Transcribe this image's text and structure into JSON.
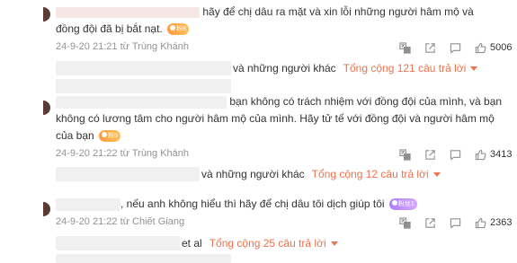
{
  "comments": [
    {
      "text_line1": "hãy để chị dâu ra mặt và xin lỗi những người hâm mộ và",
      "text_line2": "đồng đội đã bị bắt nạt.",
      "badge": "粉8",
      "date": "24-9-20 21:21",
      "from": "từ Trùng Khánh",
      "likes": "5006",
      "replies_prefix": "và những người khác",
      "replies_total": "Tổng cộng 121 câu trả lời"
    },
    {
      "text_line1": "bạn không có trách nhiệm với đồng đội của mình, và bạn",
      "text_line2": "không có lương tâm cho người hâm mộ của mình. Hãy tử tế với đồng đội và người hâm mộ",
      "text_line3": "của bạn",
      "badge": "粉8",
      "date": "24-9-20 21:22",
      "from": "từ Trùng Khánh",
      "likes": "3413",
      "replies_prefix": "và những người khác",
      "replies_total": "Tổng cộng 12 câu trả lời"
    },
    {
      "text_line1": ", nếu anh không hiểu thì hãy để chị dâu tôi dịch giúp tôi",
      "badge": "粉丝1",
      "date": "24-9-20 21:22",
      "from": "từ Chiết Giang",
      "likes": "2363",
      "replies_prefix": "et al",
      "replies_total": "Tổng cộng 25 câu trả lời"
    }
  ],
  "icons": {
    "translate": "translate-icon",
    "share": "share-icon",
    "comment": "comment-icon",
    "like": "like-icon"
  },
  "colors": {
    "accent": "#eb7350",
    "meta": "#939393",
    "text": "#333333"
  }
}
